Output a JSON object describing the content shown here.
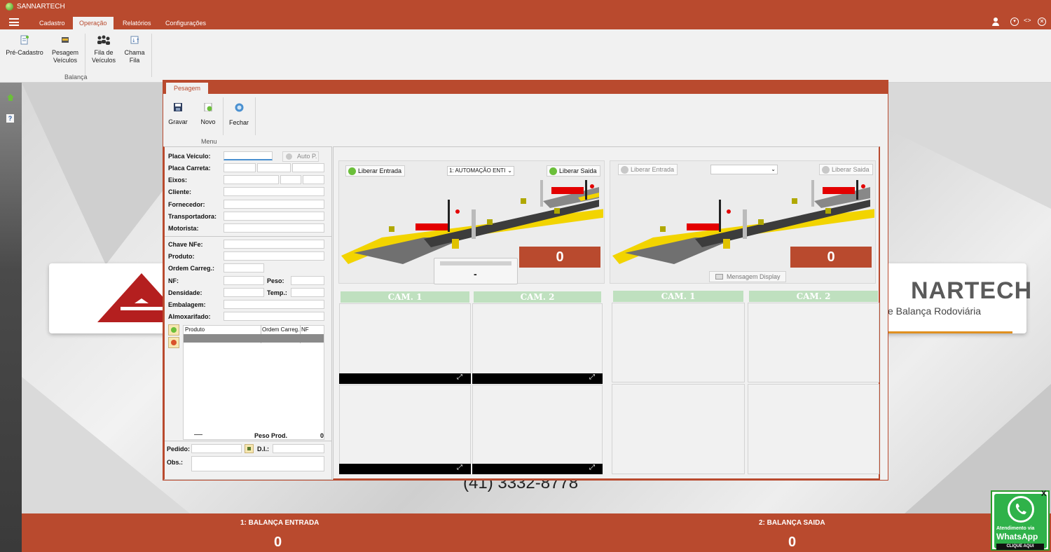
{
  "app": {
    "title": "SANNARTECH"
  },
  "menu": {
    "tabs": [
      "Cadastro",
      "Operação",
      "Relatórios",
      "Configurações"
    ]
  },
  "ribbon": {
    "buttons": [
      {
        "label": "Pré-Cadastro",
        "icon": "pre-cadastro-icon"
      },
      {
        "label": "Pesagem Veículos",
        "icon": "truck-scale-icon"
      },
      {
        "label": "Fila de Veículos",
        "icon": "queue-icon"
      },
      {
        "label": "Chama Fila",
        "icon": "call-queue-icon"
      }
    ],
    "group_label": "Balança"
  },
  "window": {
    "tab": "Pesagem",
    "toolbar": {
      "gravar": "Gravar",
      "novo": "Novo",
      "fechar": "Fechar",
      "group": "Menu"
    },
    "form": {
      "placa_veiculo": "Placa Veiculo:",
      "auto_p": "Auto P.",
      "placa_carreta": "Placa Carreta:",
      "eixos": "Eixos:",
      "cliente": "Cliente:",
      "fornecedor": "Fornecedor:",
      "transportadora": "Transportadora:",
      "motorista": "Motorista:",
      "chave_nfe": "Chave NFe:",
      "produto": "Produto:",
      "ordem_carreg": "Ordem Carreg.:",
      "nf": "NF:",
      "peso": "Peso:",
      "densidade": "Densidade:",
      "temp": "Temp.:",
      "embalagem": "Embalagem:",
      "almoxarifado": "Almoxarifado:",
      "grid_cols": [
        "Produto",
        "Ordem Carreg.",
        "NF"
      ],
      "peso_prod": "Peso Prod.",
      "peso_prod_value": "0",
      "pedido": "Pedido:",
      "di": "D.I.:",
      "obs": "Obs.:"
    },
    "scale1": {
      "liberar_entrada": "Liberar Entrada",
      "select_value": "1: AUTOMAÇÃO ENTI",
      "liberar_saida": "Liberar Saida",
      "weight": "0",
      "display": "-"
    },
    "scale2": {
      "liberar_entrada": "Liberar Entrada",
      "select_value": "",
      "liberar_saida": "Liberar Saida",
      "weight": "0",
      "mensagem": "Mensagem Display"
    },
    "cams": {
      "cam1": "CAM. 1",
      "cam2": "CAM. 2"
    }
  },
  "background": {
    "brand_partial": "NARTECH",
    "subtitle_partial": "e Balança Rodoviária",
    "phone": "(41) 3332-8778"
  },
  "bottom": {
    "scale1_label": "1: BALANÇA ENTRADA",
    "scale1_value": "0",
    "scale2_label": "2: BALANÇA SAIDA",
    "scale2_value": "0"
  },
  "whatsapp": {
    "line1": "Atendimento via",
    "line2": "WhatsApp",
    "line3": "CLIQUE AQUI",
    "close": "X"
  },
  "colors": {
    "brand": "#b94a2e",
    "cam_header": "#bfe0bf",
    "check": "#6bbf3a"
  }
}
